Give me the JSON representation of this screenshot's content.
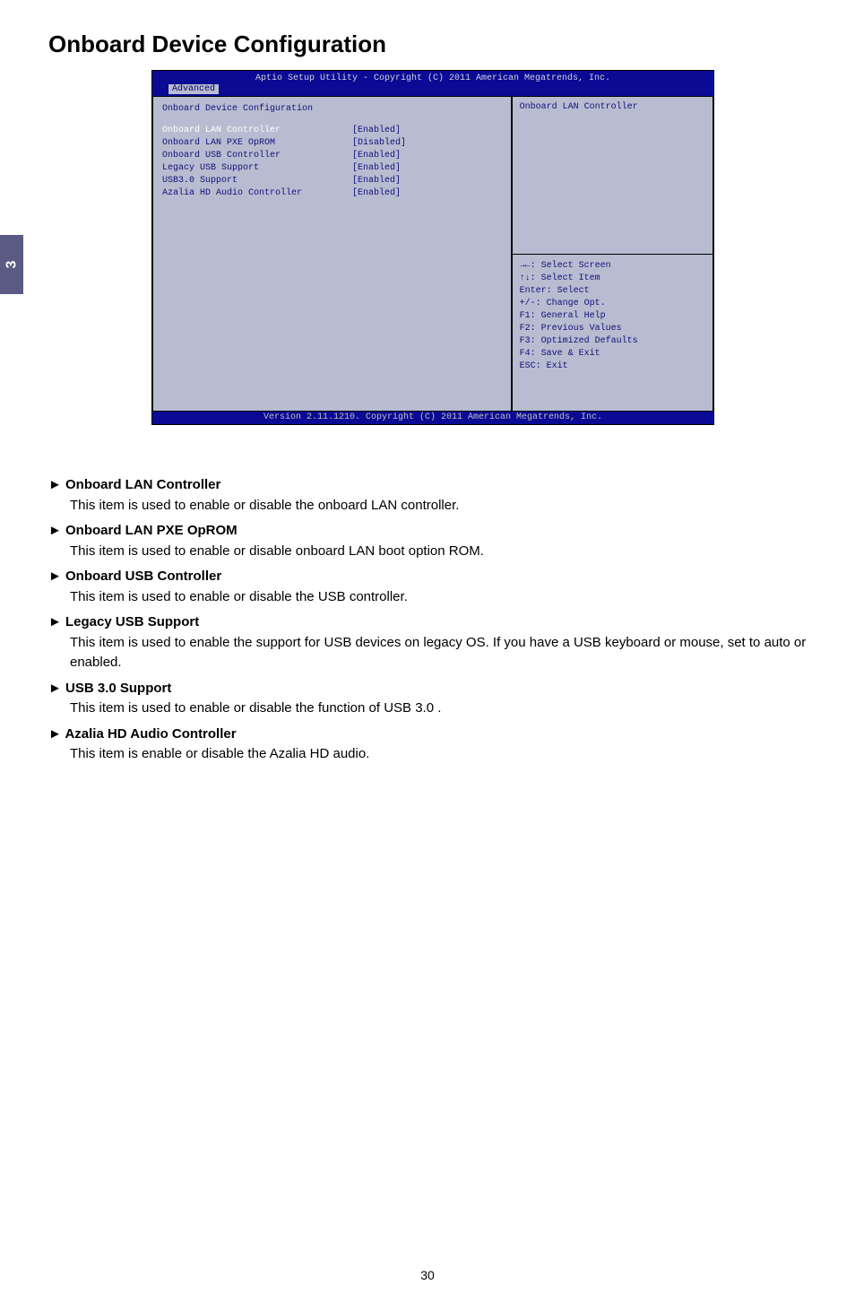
{
  "sideTab": "3",
  "pageTitle": "Onboard Device Configuration",
  "bios": {
    "headerTop": "Aptio Setup Utility - Copyright (C) 2011 American Megatrends, Inc.",
    "tab": "Advanced",
    "sectionTitle": "Onboard Device Configuration",
    "rows": [
      {
        "label": "Onboard LAN Controller",
        "value": "[Enabled]",
        "highlight": true
      },
      {
        "label": "Onboard LAN PXE OpROM",
        "value": "[Disabled]",
        "highlight": false
      },
      {
        "label": "Onboard USB Controller",
        "value": "[Enabled]",
        "highlight": false
      },
      {
        "label": "Legacy USB Support",
        "value": "[Enabled]",
        "highlight": false
      },
      {
        "label": "USB3.0 Support",
        "value": "[Enabled]",
        "highlight": false
      },
      {
        "label": "Azalia HD Audio Controller",
        "value": "[Enabled]",
        "highlight": false
      }
    ],
    "helpTop": "Onboard LAN Controller",
    "helpBottom": [
      "→←: Select Screen",
      "↑↓: Select Item",
      "Enter: Select",
      "+/-: Change Opt.",
      "F1: General Help",
      "F2: Previous Values",
      "F3: Optimized Defaults",
      "F4: Save & Exit",
      "ESC: Exit"
    ],
    "footer": "Version 2.11.1210. Copyright (C) 2011 American Megatrends, Inc."
  },
  "items": [
    {
      "title": "► Onboard LAN Controller",
      "desc": "This item is used to enable or disable the onboard LAN controller."
    },
    {
      "title": "► Onboard LAN PXE OpROM",
      "desc": "This item is used to enable or disable onboard LAN boot option ROM."
    },
    {
      "title": "► Onboard USB Controller",
      "desc": "This item is used to enable or disable the USB controller."
    },
    {
      "title": "► Legacy USB Support",
      "desc": "This item is used to enable the support for USB devices on legacy OS. If you have a USB keyboard or mouse, set to auto or enabled."
    },
    {
      "title": "► USB 3.0 Support",
      "desc": "This item is used to enable or disable the function of USB 3.0 ."
    },
    {
      "title": "► Azalia HD Audio Controller",
      "desc": "This item is enable or disable the Azalia HD audio."
    }
  ],
  "pageNumber": "30"
}
